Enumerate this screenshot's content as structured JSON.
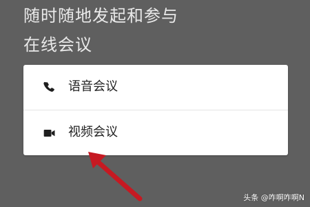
{
  "screen": {
    "headline_line_1": "随时随地发起和参与",
    "headline_line_2": "在线会议",
    "background_color": "#5f5f5f",
    "headline_color": "#e9e9e9"
  },
  "menu": {
    "items": [
      {
        "label": "语音会议",
        "icon": "phone-icon"
      },
      {
        "label": "视频会议",
        "icon": "video-camera-icon"
      }
    ],
    "card_color": "#ffffff",
    "divider_color": "#e4e4e4",
    "text_color": "#222222"
  },
  "annotation": {
    "pointer": "red-arrow-icon",
    "pointer_color": "#c61922"
  },
  "watermark": {
    "text": "头条 @咋啊咋啊N"
  }
}
